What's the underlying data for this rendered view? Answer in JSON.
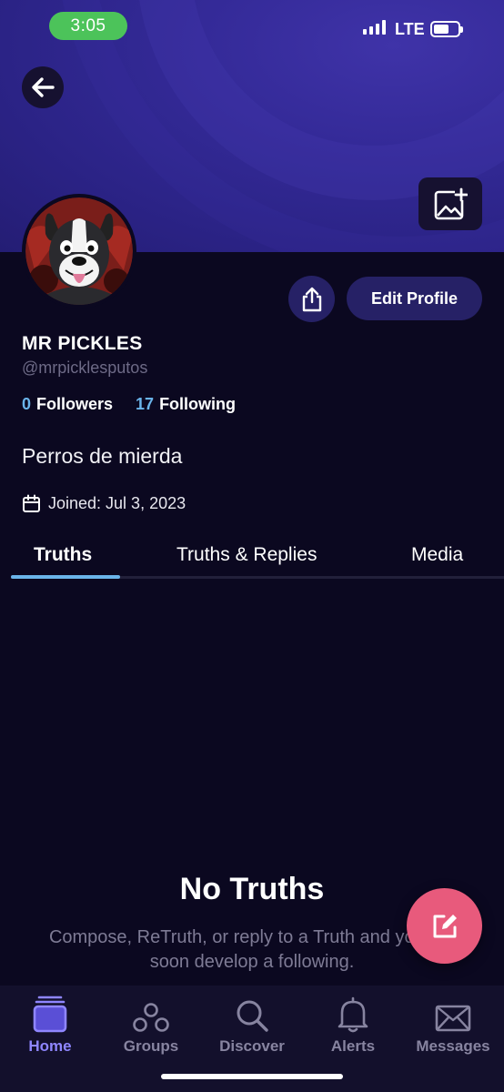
{
  "status_bar": {
    "time": "3:05",
    "network": "LTE"
  },
  "profile": {
    "display_name": "MR PICKLES",
    "handle": "@mrpicklesputos",
    "followers_count": "0",
    "followers_label": "Followers",
    "following_count": "17",
    "following_label": "Following",
    "bio": "Perros de mierda",
    "joined": "Joined: Jul 3, 2023",
    "edit_button": "Edit Profile"
  },
  "tabs": [
    {
      "label": "Truths",
      "active": true
    },
    {
      "label": "Truths & Replies",
      "active": false
    },
    {
      "label": "Media",
      "active": false
    }
  ],
  "empty_state": {
    "title": "No Truths",
    "subtitle": "Compose, ReTruth, or reply to a Truth and you will soon develop a following."
  },
  "bottom_nav": [
    {
      "label": "Home",
      "icon": "home-icon",
      "active": true
    },
    {
      "label": "Groups",
      "icon": "groups-icon",
      "active": false
    },
    {
      "label": "Discover",
      "icon": "search-icon",
      "active": false
    },
    {
      "label": "Alerts",
      "icon": "bell-icon",
      "active": false
    },
    {
      "label": "Messages",
      "icon": "envelope-icon",
      "active": false
    }
  ],
  "colors": {
    "background": "#0b0820",
    "cover": "#2b2386",
    "accent_blue": "#6ab4ea",
    "accent_purple": "#8f86ff",
    "fab": "#e85a7c",
    "button": "#262166"
  }
}
